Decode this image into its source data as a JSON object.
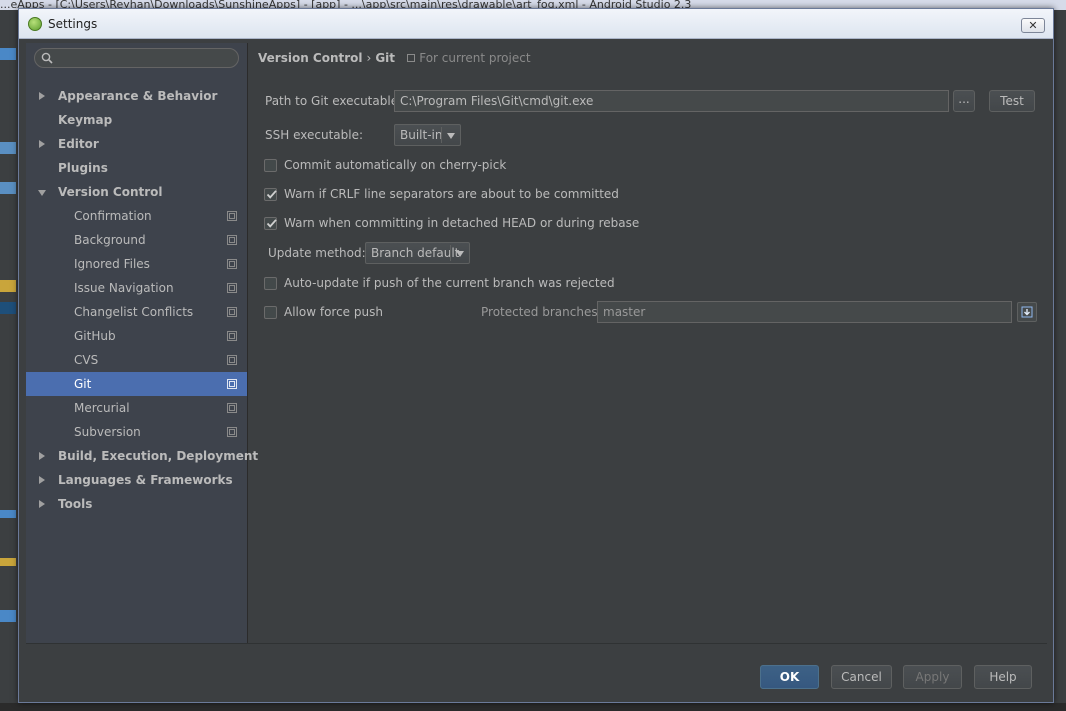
{
  "ide": {
    "title_fragment": "...eApps - [C:\\Users\\Reyhan\\Downloads\\SunshineApps] - [app] - ...\\app\\src\\main\\res\\drawable\\art_fog.xml - Android Studio 2.3"
  },
  "dialog": {
    "title": "Settings",
    "close_glyph": "✕"
  },
  "search": {
    "placeholder": "",
    "value": ""
  },
  "tree": [
    {
      "label": "Appearance & Behavior",
      "level": 0,
      "expandable": true,
      "expanded": false
    },
    {
      "label": "Keymap",
      "level": 0,
      "expandable": false
    },
    {
      "label": "Editor",
      "level": 0,
      "expandable": true,
      "expanded": false
    },
    {
      "label": "Plugins",
      "level": 0,
      "expandable": false
    },
    {
      "label": "Version Control",
      "level": 0,
      "expandable": true,
      "expanded": true
    },
    {
      "label": "Confirmation",
      "level": 1
    },
    {
      "label": "Background",
      "level": 1
    },
    {
      "label": "Ignored Files",
      "level": 1
    },
    {
      "label": "Issue Navigation",
      "level": 1
    },
    {
      "label": "Changelist Conflicts",
      "level": 1
    },
    {
      "label": "GitHub",
      "level": 1
    },
    {
      "label": "CVS",
      "level": 1
    },
    {
      "label": "Git",
      "level": 1,
      "selected": true
    },
    {
      "label": "Mercurial",
      "level": 1
    },
    {
      "label": "Subversion",
      "level": 1
    },
    {
      "label": "Build, Execution, Deployment",
      "level": 0,
      "expandable": true,
      "expanded": false
    },
    {
      "label": "Languages & Frameworks",
      "level": 0,
      "expandable": true,
      "expanded": false
    },
    {
      "label": "Tools",
      "level": 0,
      "expandable": true,
      "expanded": false
    }
  ],
  "breadcrumb": {
    "section": "Version Control",
    "separator": "›",
    "page": "Git",
    "scope": "For current project"
  },
  "git": {
    "path_label": "Path to Git executable:",
    "path_value": "C:\\Program Files\\Git\\cmd\\git.exe",
    "browse_label": "...",
    "test_label": "Test",
    "ssh_label": "SSH executable:",
    "ssh_value": "Built-in",
    "commit_cherry_pick_label": "Commit automatically on cherry-pick",
    "commit_cherry_pick_checked": false,
    "warn_crlf_label": "Warn if CRLF line separators are about to be committed",
    "warn_crlf_checked": true,
    "warn_detached_label": "Warn when committing in detached HEAD or during rebase",
    "warn_detached_checked": true,
    "update_method_label": "Update method:",
    "update_method_value": "Branch default",
    "auto_update_label": "Auto-update if push of the current branch was rejected",
    "auto_update_checked": false,
    "force_push_label": "Allow force push",
    "force_push_checked": false,
    "protected_branches_label": "Protected branches:",
    "protected_branches_value": "master"
  },
  "footer": {
    "ok": "OK",
    "cancel": "Cancel",
    "apply": "Apply",
    "help": "Help"
  },
  "colors": {
    "background": "#3c3f41",
    "sidebar": "#3e434c",
    "selection": "#4b6eaf",
    "text": "#bbbbbb"
  }
}
